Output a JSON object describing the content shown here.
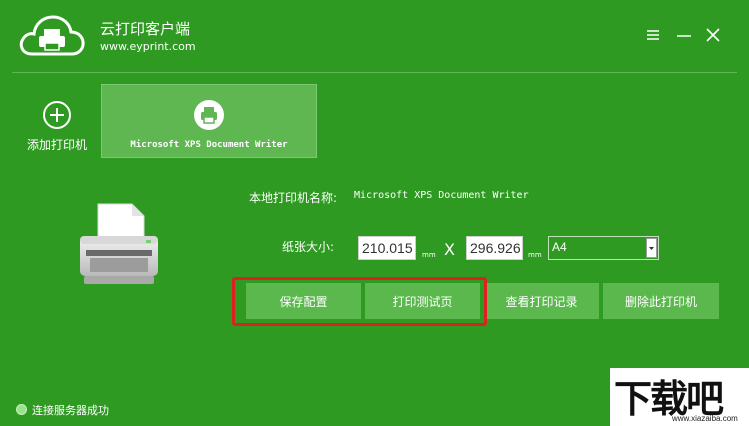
{
  "app": {
    "title": "云打印客户端",
    "url": "www.eyprint.com"
  },
  "window_controls": {
    "menu_icon": "menu-icon",
    "minimize_icon": "minimize-icon",
    "close_icon": "close-icon"
  },
  "printers": {
    "add_label": "添加打印机",
    "tabs": [
      {
        "label": "Microsoft XPS Document Writer",
        "selected": true
      }
    ]
  },
  "form": {
    "printer_name_label": "本地打印机名称:",
    "printer_name_value": "Microsoft XPS Document Writer",
    "paper_size_label": "纸张大小:",
    "width": "210.015",
    "height": "296.926",
    "unit": "mm",
    "times": "X",
    "paper_type": "A4"
  },
  "buttons": {
    "save": "保存配置",
    "test_page": "打印测试页",
    "view_log": "查看打印记录",
    "delete_printer": "删除此打印机"
  },
  "status": {
    "text": "连接服务器成功",
    "color": "#9be38a"
  },
  "watermark": {
    "text": "下载吧",
    "url": "www.xiazaiba.com"
  },
  "colors": {
    "background": "#2f9a22",
    "panel": "#5ab84d",
    "highlight": "#e02020"
  }
}
